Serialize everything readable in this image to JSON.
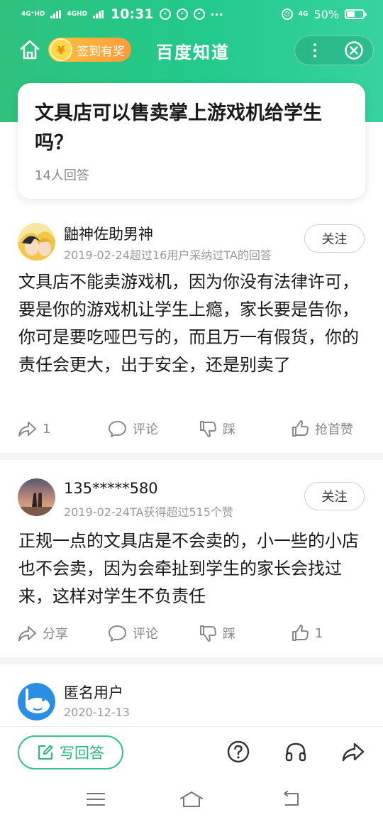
{
  "status_bar": {
    "signal1": "4G⁺HD",
    "signal2": "4GHD",
    "time": "10:31",
    "net": "4G",
    "battery": "50%",
    "battery_level": 0.5
  },
  "nav": {
    "sign_label": "签到有奖",
    "coin_glyph": "¥",
    "title": "百度知道"
  },
  "question": {
    "title": "文具店可以售卖掌上游戏机给学生吗？",
    "count": "14人回答"
  },
  "answers": [
    {
      "author": "鼬神佐助男神",
      "meta": "2019-02-24超过16用户采纳过TA的回答",
      "follow": "关注",
      "text": "文具店不能卖游戏机，因为你没有法律许可，要是你的游戏机让学生上瘾，家长要是告你，你可是要吃哑巴亏的，而且万一有假货，你的责任会更大，出于安全，还是别卖了",
      "share": "1",
      "comment": "评论",
      "dislike": "踩",
      "like": "抢首赞"
    },
    {
      "author": "135*****580",
      "meta": "2019-02-24TA获得超过515个赞",
      "follow": "关注",
      "text": "正规一点的文具店是不会卖的，小一些的小店也不会卖，因为会牵扯到学生的家长会找过来，这样对学生不负责任",
      "share": "分享",
      "comment": "评论",
      "dislike": "踩",
      "like": "1"
    },
    {
      "author": "匿名用户",
      "meta": "2020-12-13"
    }
  ],
  "bottom": {
    "write_label": "写回答"
  },
  "colors": {
    "brand_green": "#2ec27e",
    "accent_orange": "#ff9a3c"
  },
  "icons": [
    "home-icon",
    "more-icon",
    "close-icon",
    "share-icon",
    "comment-icon",
    "dislike-icon",
    "like-icon",
    "edit-icon",
    "help-icon",
    "headphones-icon",
    "forward-icon",
    "menu-icon",
    "house-icon",
    "back-icon"
  ]
}
